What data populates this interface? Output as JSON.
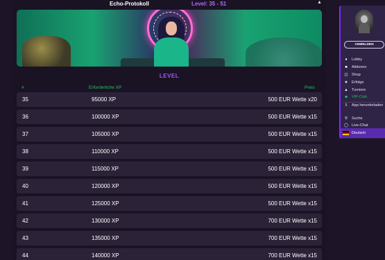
{
  "header": {
    "title": "Echo-Protokoll",
    "level_range": "Level: 35 - 51"
  },
  "section": {
    "heading": "LEVEL"
  },
  "table": {
    "columns": [
      "#",
      "Erforderliche XP",
      "Preis"
    ],
    "rows": [
      {
        "level": "35",
        "xp": "95000 XP",
        "prize": "500 EUR Wette x20"
      },
      {
        "level": "36",
        "xp": "100000 XP",
        "prize": "500 EUR Wette x15"
      },
      {
        "level": "37",
        "xp": "105000 XP",
        "prize": "500 EUR Wette x15"
      },
      {
        "level": "38",
        "xp": "110000 XP",
        "prize": "500 EUR Wette x15"
      },
      {
        "level": "39",
        "xp": "115000 XP",
        "prize": "500 EUR Wette x15"
      },
      {
        "level": "40",
        "xp": "120000 XP",
        "prize": "500 EUR Wette x15"
      },
      {
        "level": "41",
        "xp": "125000 XP",
        "prize": "500 EUR Wette x15"
      },
      {
        "level": "42",
        "xp": "130000 XP",
        "prize": "700 EUR Wette x15"
      },
      {
        "level": "43",
        "xp": "135000 XP",
        "prize": "700 EUR Wette x15"
      },
      {
        "level": "44",
        "xp": "140000 XP",
        "prize": "700 EUR Wette x15"
      }
    ]
  },
  "sidebar": {
    "login_label": "ANMELDEN",
    "items": [
      {
        "label": "Lobby",
        "icon": "gamepad-icon",
        "active": false
      },
      {
        "label": "Aktionen",
        "icon": "gift-icon",
        "active": false
      },
      {
        "label": "Shop",
        "icon": "cart-icon",
        "active": false
      },
      {
        "label": "Erfolge",
        "icon": "trophy-icon",
        "active": false
      },
      {
        "label": "Turniere",
        "icon": "tournament-icon",
        "active": false
      },
      {
        "label": "VIP-Club",
        "icon": "diamond-icon",
        "active": true
      }
    ],
    "extra_items": [
      {
        "label": "App herunterladen",
        "icon": "download-icon"
      },
      {
        "label": "Suche",
        "icon": "search-icon"
      },
      {
        "label": "Live-Chat",
        "icon": "chat-icon"
      }
    ],
    "language": "Deutsch"
  },
  "colors": {
    "accent_purple": "#a456ff",
    "accent_green": "#22c35e",
    "row_bg": "#2b2238",
    "sidebar_bg": "#2f2346"
  }
}
